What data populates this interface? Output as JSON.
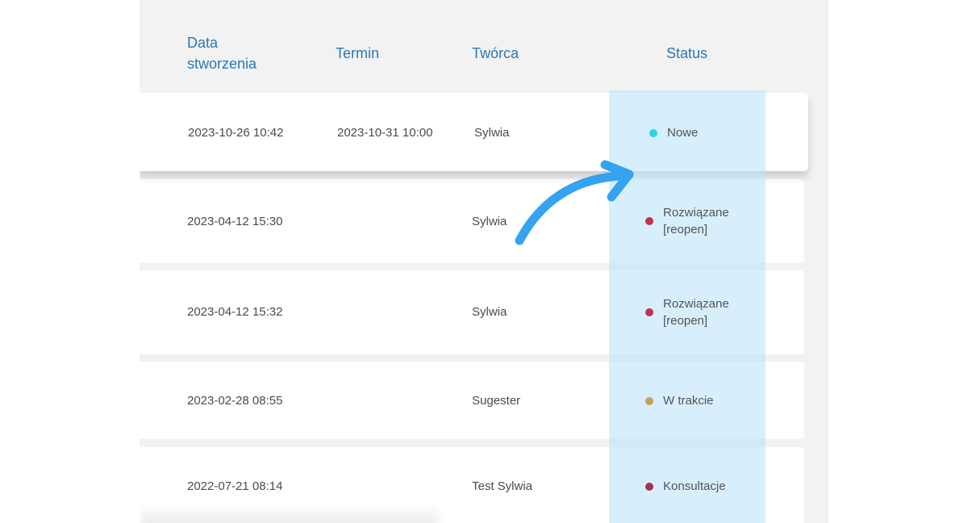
{
  "table": {
    "headers": {
      "created_line1": "Data",
      "created_line2": "stworzenia",
      "deadline": "Termin",
      "creator": "Twórca",
      "status": "Status"
    },
    "rows": [
      {
        "created": "2023-10-26 10:42",
        "deadline": "2023-10-31 10:00",
        "creator": "Sylwia",
        "status_line1": "Nowe",
        "status_line2": "",
        "status_color": "#2cd4e8"
      },
      {
        "created": "2023-04-12 15:30",
        "deadline": "",
        "creator": "Sylwia",
        "status_line1": "Rozwiązane",
        "status_line2": "[reopen]",
        "status_color": "#c0344a"
      },
      {
        "created": "2023-04-12 15:32",
        "deadline": "",
        "creator": "Sylwia",
        "status_line1": "Rozwiązane",
        "status_line2": "[reopen]",
        "status_color": "#c0344a"
      },
      {
        "created": "2023-02-28 08:55",
        "deadline": "",
        "creator": "Sugester",
        "status_line1": "W trakcie",
        "status_line2": "",
        "status_color": "#c9a053"
      },
      {
        "created": "2022-07-21 08:14",
        "deadline": "",
        "creator": "Test Sylwia",
        "status_line1": "Konsultacje",
        "status_line2": "",
        "status_color": "#a0354e"
      }
    ]
  },
  "colors": {
    "header_text": "#2a78b7",
    "status_column_highlight": "#bee4fc",
    "arrow": "#34a3f0"
  },
  "annotation": {
    "icon": "curved-arrow-icon"
  }
}
